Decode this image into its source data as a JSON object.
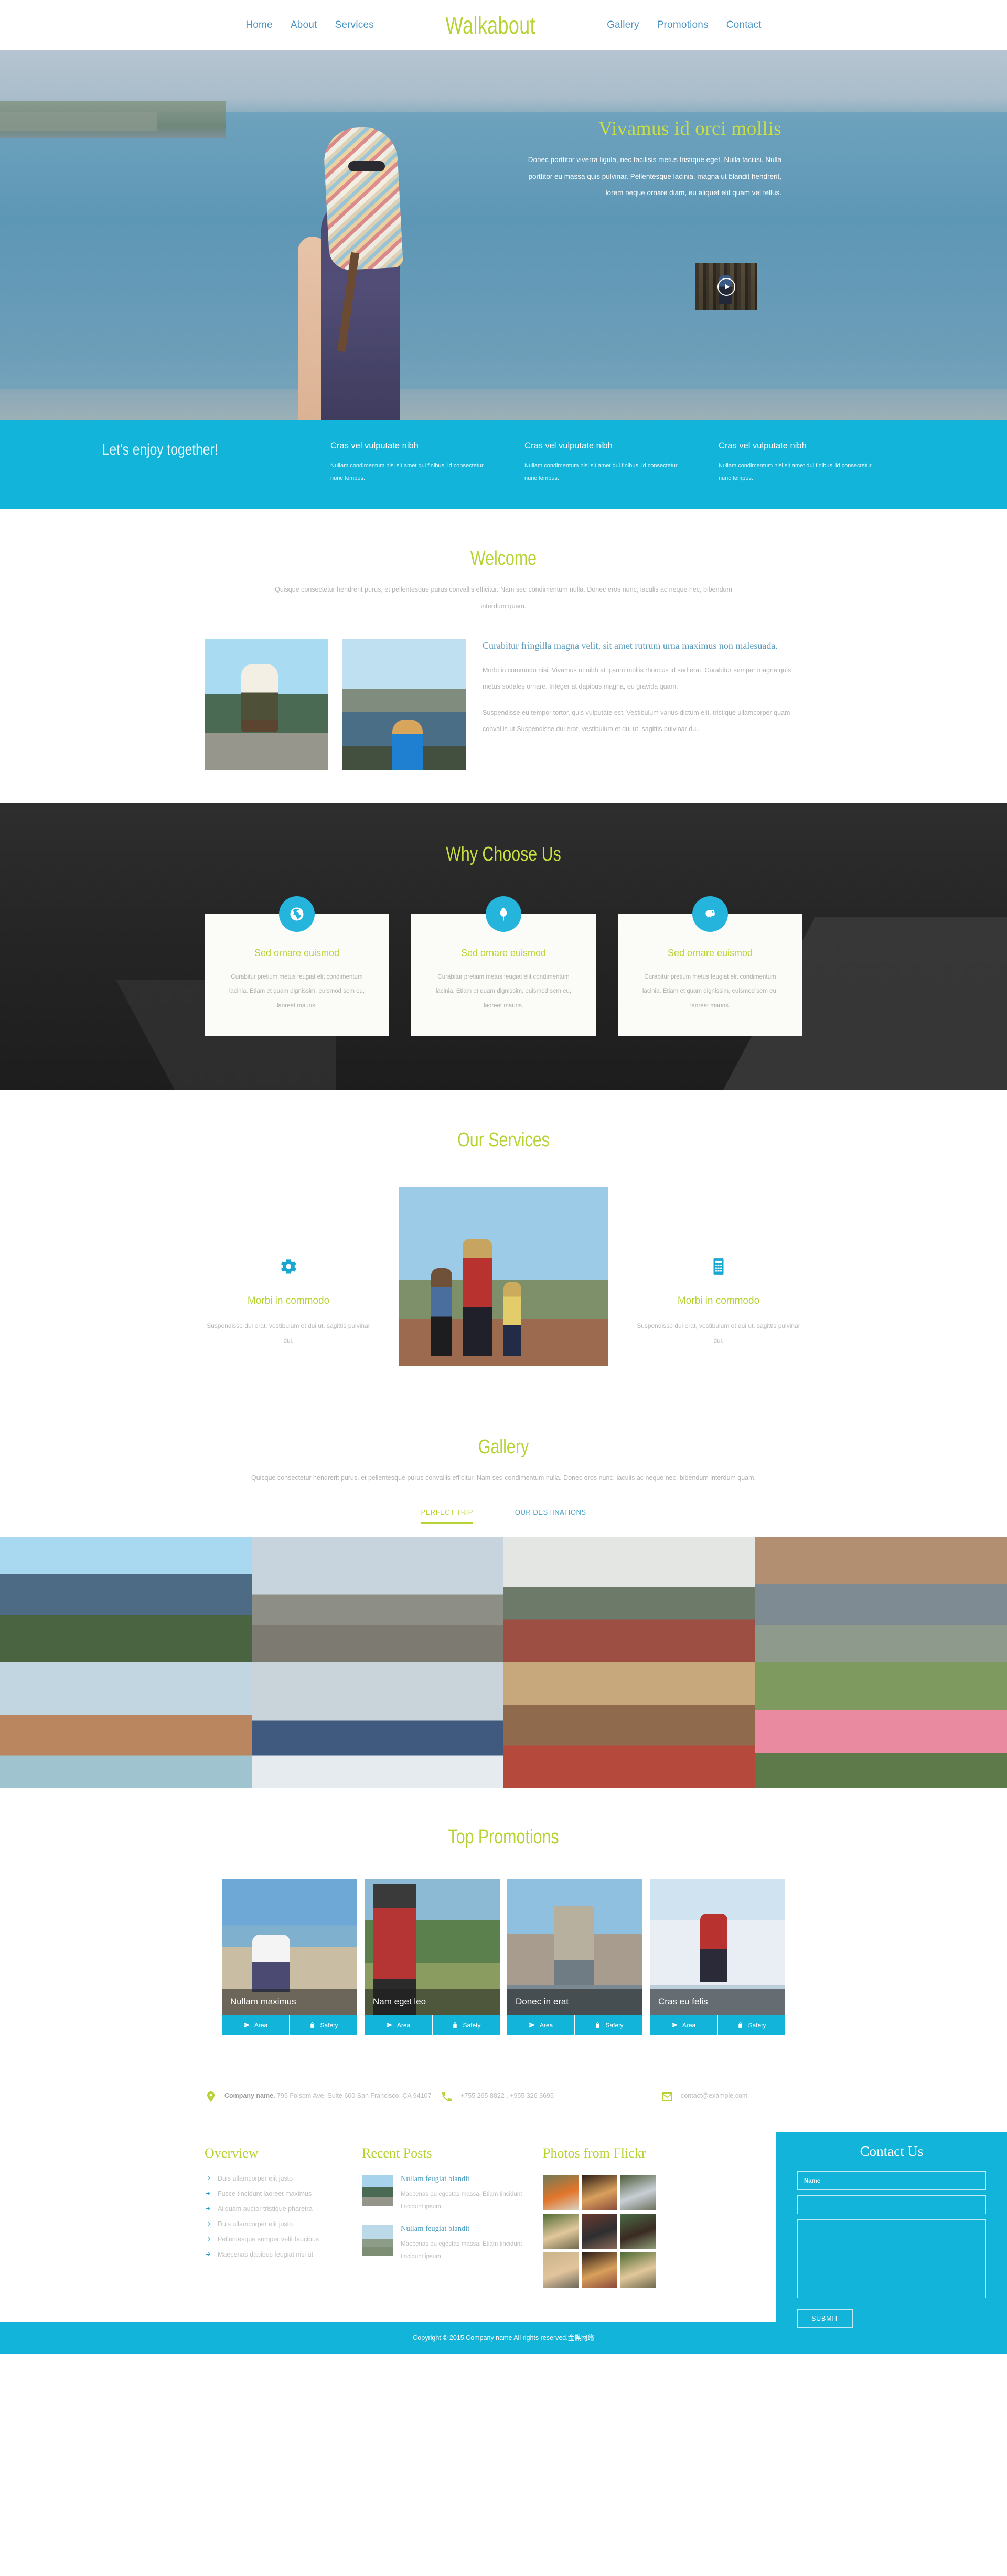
{
  "header": {
    "logo": "Walkabout",
    "nav_left": [
      {
        "label": "Home"
      },
      {
        "label": "About"
      },
      {
        "label": "Services"
      }
    ],
    "nav_right": [
      {
        "label": "Gallery"
      },
      {
        "label": "Promotions"
      },
      {
        "label": "Contact"
      }
    ]
  },
  "hero": {
    "title": "Vivamus id orci mollis",
    "description": "Donec porttitor viverra ligula, nec facilisis metus tristique eget. Nulla facilisi. Nulla porttitor eu massa quis pulvinar. Pellentesque lacinia, magna ut blandit hendrerit, lorem neque ornare diam, eu aliquet elit quam vel tellus.",
    "video_icon": "play-icon"
  },
  "enjoy": {
    "title": "Let's enjoy together!",
    "columns": [
      {
        "heading": "Cras vel vulputate nibh",
        "text": "Nullam condimentum nisi sit amet dui finibus, id consectetur nunc tempus."
      },
      {
        "heading": "Cras vel vulputate nibh",
        "text": "Nullam condimentum nisi sit amet dui finibus, id consectetur nunc tempus."
      },
      {
        "heading": "Cras vel vulputate nibh",
        "text": "Nullam condimentum nisi sit amet dui finibus, id consectetur nunc tempus."
      }
    ]
  },
  "welcome": {
    "title": "Welcome",
    "subtitle": "Quisque consectetur hendrerit purus, et pellentesque purus convallis efficitur. Nam sed condimentum nulla. Donec eros nunc, iaculis ac neque nec, bibendum interdum quam.",
    "heading": "Curabitur fringilla magna velit, sit amet rutrum urna maximus non malesuada.",
    "paragraph1": "Morbi in commodo nisi. Vivamus ut nibh at ipsum mollis rhoncus id sed erat. Curabitur semper magna quis metus sodales ornare. Integer at dapibus magna, eu gravida quam.",
    "paragraph2": "Suspendisse eu tempor tortor, quis vulputate est. Vestibulum varius dictum elit, tristique ullamcorper quam convallis ut.Suspendisse dui erat, vestibulum et dui ut, sagittis pulvinar dui."
  },
  "why": {
    "title": "Why Choose Us",
    "cards": [
      {
        "icon": "globe-icon",
        "heading": "Sed ornare euismod",
        "text": "Curabitur pretium metus feugiat elit condimentum lacinia. Etiam et quam dignissim, euismod sem eu, laoreet mauris."
      },
      {
        "icon": "tree-icon",
        "heading": "Sed ornare euismod",
        "text": "Curabitur pretium metus feugiat elit condimentum lacinia. Etiam et quam dignissim, euismod sem eu, laoreet mauris."
      },
      {
        "icon": "piggy-bank-icon",
        "heading": "Sed ornare euismod",
        "text": "Curabitur pretium metus feugiat elit condimentum lacinia. Etiam et quam dignissim, euismod sem eu, laoreet mauris."
      }
    ]
  },
  "services": {
    "title": "Our Services",
    "left": {
      "icon": "gear-icon",
      "heading": "Morbi in commodo",
      "text": "Suspendisse dui erat, vestibulum et dui ut, sagittis pulvinar dui."
    },
    "right": {
      "icon": "calculator-icon",
      "heading": "Morbi in commodo",
      "text": "Suspendisse dui erat, vestibulum et dui ut, sagittis pulvinar dui."
    }
  },
  "gallery": {
    "title": "Gallery",
    "subtitle": "Quisque consectetur hendrerit purus, et pellentesque purus convallis efficitur. Nam sed condimentum nulla. Donec eros nunc, iaculis ac neque nec, bibendum interdum quam.",
    "tabs": [
      {
        "label": "PERFECT TRIP",
        "active": true
      },
      {
        "label": "OUR DESTINATIONS",
        "active": false
      }
    ]
  },
  "promotions": {
    "title": "Top Promotions",
    "cards": [
      {
        "caption": "Nullam maximus",
        "action_area": "Area",
        "action_safety": "Safety"
      },
      {
        "caption": "Nam eget leo",
        "action_area": "Area",
        "action_safety": "Safety"
      },
      {
        "caption": "Donec in erat",
        "action_area": "Area",
        "action_safety": "Safety"
      },
      {
        "caption": "Cras eu felis",
        "action_area": "Area",
        "action_safety": "Safety"
      }
    ]
  },
  "info": {
    "address_company": "Company name.",
    "address_rest": " 795 Folsom Ave, Suite 600 San Francisco, CA 94107",
    "phone": "+755 265 8822 , +955 326 3695",
    "email": "contact@example.com"
  },
  "footer": {
    "overview": {
      "title": "Overview",
      "links": [
        "Duis ullamcorper elit justo",
        "Fusce tincidunt laoreet maximus",
        "Aliquam auctor tristique pharetra",
        "Duis ullamcorper elit justo",
        "Pellentesque semper velit faucibus",
        "Maecenas dapibus feugiat nisi ut"
      ]
    },
    "recent_posts": {
      "title": "Recent Posts",
      "posts": [
        {
          "heading": "Nullam feugiat blandit",
          "text": "Maecenas eu egestas massa. Etiam tincidunt tincidunt ipsum."
        },
        {
          "heading": "Nullam feugiat blandit",
          "text": "Maecenas eu egestas massa. Etiam tincidunt tincidunt ipsum."
        }
      ]
    },
    "flickr": {
      "title": "Photos from Flickr"
    },
    "contact": {
      "title": "Contact Us",
      "name_placeholder": "Name",
      "name_value": "",
      "email_placeholder": "",
      "email_value": "",
      "message_placeholder": "",
      "message_value": "",
      "submit_label": "SUBMIT"
    }
  },
  "copyright": "Copyright © 2015.Company name All rights reserved.金黑网络",
  "colors": {
    "accent_green": "#b5d334",
    "accent_cyan": "#12b4da",
    "link_blue": "#4a94c4",
    "body_text": "#b5b5b5",
    "dark_section": "#262626"
  }
}
